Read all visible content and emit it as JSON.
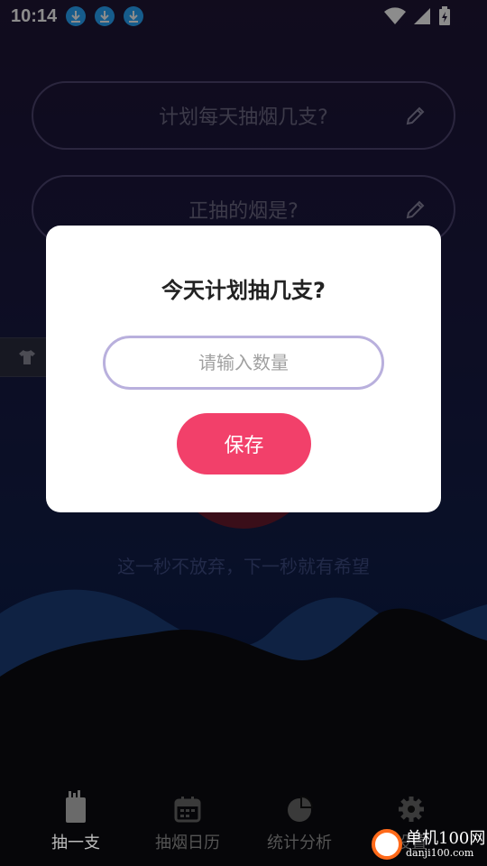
{
  "status_bar": {
    "time": "10:14",
    "download_icons": [
      "download-icon",
      "download-icon",
      "download-icon"
    ],
    "right_icons": [
      "wifi-icon",
      "signal-icon",
      "battery-icon"
    ]
  },
  "background": {
    "plan_placeholder": "计划每天抽烟几支?",
    "brand_placeholder": "正抽的烟是?",
    "motto": "这一秒不放弃，下一秒就有希望"
  },
  "dialog": {
    "title": "今天计划抽几支?",
    "input_placeholder": "请输入数量",
    "input_value": "",
    "save_label": "保存"
  },
  "nav": {
    "items": [
      {
        "label": "抽一支",
        "icon": "cigarette-pack-icon",
        "active": true
      },
      {
        "label": "抽烟日历",
        "icon": "calendar-icon",
        "active": false
      },
      {
        "label": "统计分析",
        "icon": "pie-chart-icon",
        "active": false
      },
      {
        "label": "设置",
        "icon": "gear-icon",
        "active": false
      }
    ]
  },
  "watermark": {
    "title": "单机100网",
    "url": "danji100.com"
  },
  "colors": {
    "accent": "#f2406a",
    "input_border": "#b9b0dd",
    "dialog_bg": "#ffffff"
  }
}
